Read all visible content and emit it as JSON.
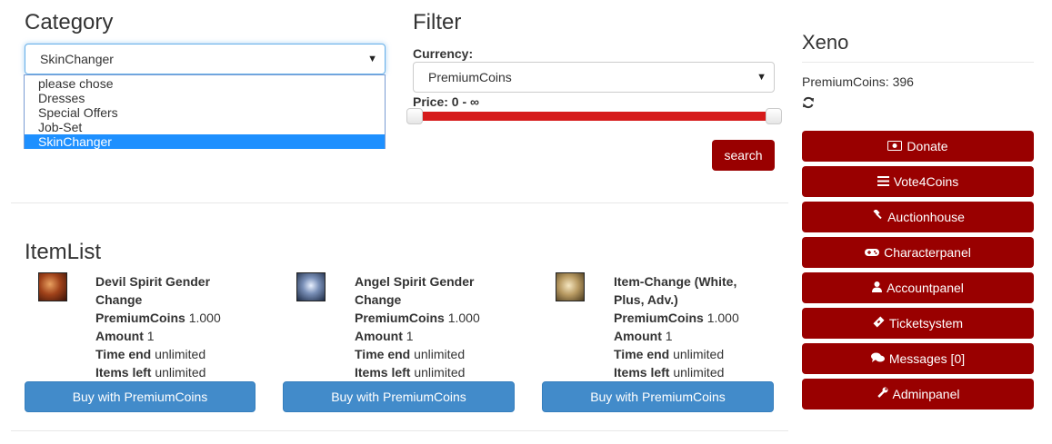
{
  "category": {
    "title": "Category",
    "selected": "SkinChanger",
    "options": [
      "please chose",
      "Dresses",
      "Special Offers",
      "Job-Set",
      "SkinChanger"
    ]
  },
  "filter": {
    "title": "Filter",
    "currency_label": "Currency:",
    "currency_selected": "PremiumCoins",
    "price_label": "Price: 0 - ∞",
    "search_label": "search",
    "slider_fill_fraction": 1.0
  },
  "itemlist": {
    "title": "ItemList",
    "items": [
      {
        "name_line1": "Devil Spirit Gender",
        "name_line2": "Change",
        "price_label": "PremiumCoins",
        "price_value": "1.000",
        "amount_label": "Amount",
        "amount_value": "1",
        "time_label": "Time end",
        "time_value": "unlimited",
        "left_label": "Items left",
        "left_value": "unlimited",
        "buy_label": "Buy with PremiumCoins",
        "icon": "devil-spirit-icon"
      },
      {
        "name_line1": "Angel Spirit Gender",
        "name_line2": "Change",
        "price_label": "PremiumCoins",
        "price_value": "1.000",
        "amount_label": "Amount",
        "amount_value": "1",
        "time_label": "Time end",
        "time_value": "unlimited",
        "left_label": "Items left",
        "left_value": "unlimited",
        "buy_label": "Buy with PremiumCoins",
        "icon": "angel-spirit-icon"
      },
      {
        "name_line1": "Item-Change (White,",
        "name_line2": "Plus, Adv.)",
        "price_label": "PremiumCoins",
        "price_value": "1.000",
        "amount_label": "Amount",
        "amount_value": "1",
        "time_label": "Time end",
        "time_value": "unlimited",
        "left_label": "Items left",
        "left_value": "unlimited",
        "buy_label": "Buy with PremiumCoins",
        "icon": "item-change-icon"
      }
    ]
  },
  "user": {
    "name": "Xeno",
    "balance": "PremiumCoins: 396",
    "refresh_icon": "refresh-icon"
  },
  "sidebar": {
    "buttons": [
      {
        "label": "Donate",
        "icon": "money-icon"
      },
      {
        "label": "Vote4Coins",
        "icon": "list-icon"
      },
      {
        "label": "Auctionhouse",
        "icon": "gavel-icon"
      },
      {
        "label": "Characterpanel",
        "icon": "gamepad-icon"
      },
      {
        "label": "Accountpanel",
        "icon": "user-icon"
      },
      {
        "label": "Ticketsystem",
        "icon": "ticket-icon"
      },
      {
        "label": "Messages [0]",
        "icon": "comments-icon"
      },
      {
        "label": "Adminpanel",
        "icon": "wrench-icon"
      }
    ]
  },
  "colors": {
    "accent": "#990000",
    "buy": "#428bca",
    "slider": "#d61b1b",
    "selected_option": "#1e90ff"
  }
}
